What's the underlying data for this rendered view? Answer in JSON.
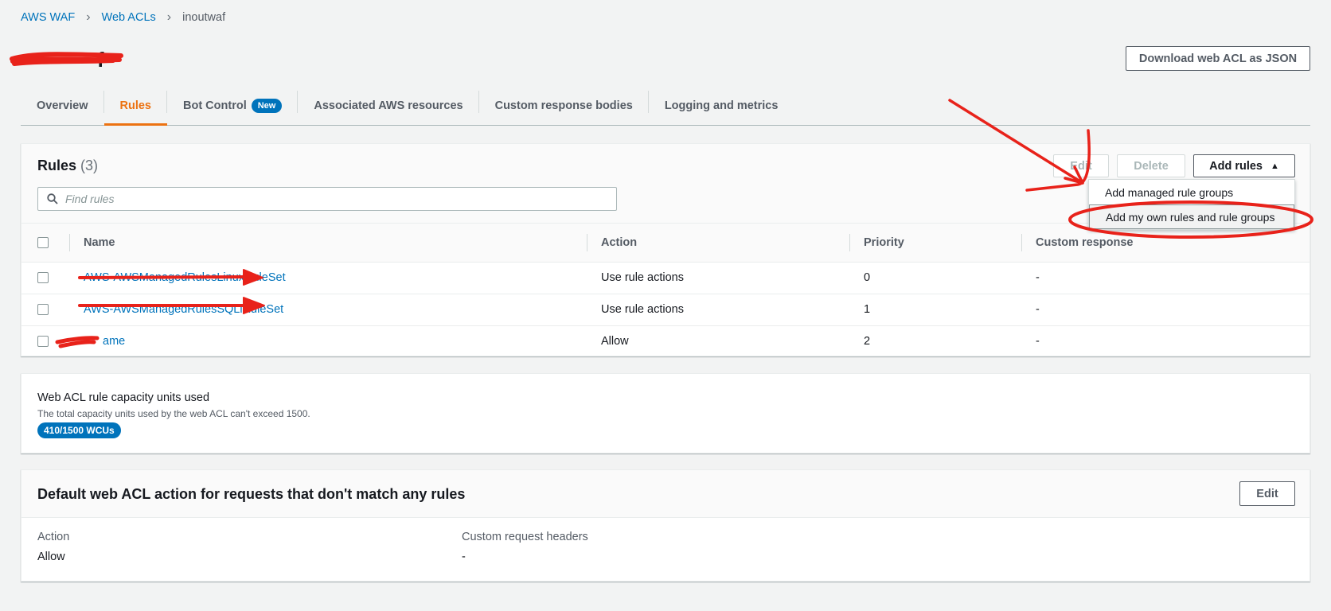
{
  "breadcrumb": {
    "item1": "AWS WAF",
    "item2": "Web ACLs",
    "current": "inoutwaf"
  },
  "page": {
    "title": "f",
    "download_label": "Download web ACL as JSON"
  },
  "tabs": [
    {
      "label": "Overview"
    },
    {
      "label": "Rules",
      "active": true
    },
    {
      "label": "Bot Control",
      "badge": "New"
    },
    {
      "label": "Associated AWS resources"
    },
    {
      "label": "Custom response bodies"
    },
    {
      "label": "Logging and metrics"
    }
  ],
  "rules": {
    "title": "Rules",
    "count": "(3)",
    "search_placeholder": "Find rules",
    "edit_label": "Edit",
    "delete_label": "Delete",
    "add_label": "Add rules",
    "menu": {
      "item1": "Add managed rule groups",
      "item2": "Add my own rules and rule groups"
    },
    "columns": {
      "name": "Name",
      "action": "Action",
      "priority": "Priority",
      "custom_response": "Custom response"
    },
    "rows": [
      {
        "name": "AWS-AWSManagedRulesLinuxRuleSet",
        "action": "Use rule actions",
        "priority": "0",
        "custom_response": "-"
      },
      {
        "name": "AWS-AWSManagedRulesSQLiRuleSet",
        "action": "Use rule actions",
        "priority": "1",
        "custom_response": "-"
      },
      {
        "name": "ame",
        "action": "Allow",
        "priority": "2",
        "custom_response": "-"
      }
    ]
  },
  "wcu": {
    "title": "Web ACL rule capacity units used",
    "description": "The total capacity units used by the web ACL can't exceed 1500.",
    "badge": "410/1500 WCUs"
  },
  "default_action": {
    "title": "Default web ACL action for requests that don't match any rules",
    "edit_label": "Edit",
    "action_label": "Action",
    "action_value": "Allow",
    "headers_label": "Custom request headers",
    "headers_value": "-"
  },
  "colors": {
    "link": "#0073bb",
    "active_tab": "#ec7211",
    "annotation": "#e8221a"
  }
}
